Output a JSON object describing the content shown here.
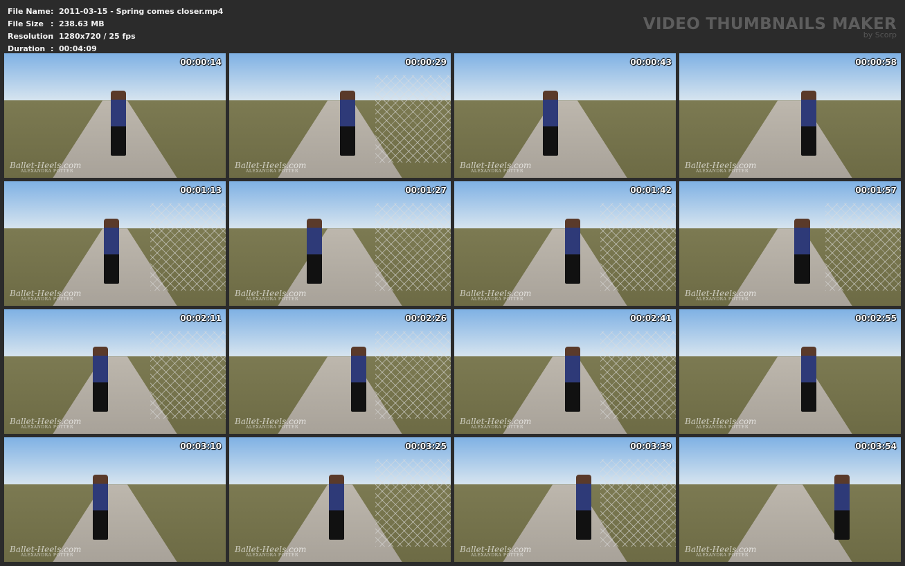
{
  "info": {
    "file_name_label": "File Name",
    "file_name": "2011-03-15 - Spring comes closer.mp4",
    "file_size_label": "File Size",
    "file_size": "238.63 MB",
    "resolution_label": "Resolution",
    "resolution": "1280x720 / 25 fps",
    "duration_label": "Duration",
    "duration": "00:04:09",
    "separator": ":"
  },
  "brand": {
    "title": "VIDEO THUMBNAILS MAKER",
    "by": "by Scorp"
  },
  "watermark": {
    "brand": "Ballet-Heels.com",
    "model": "ALEXANDRA POTTER"
  },
  "thumbnails": [
    {
      "timestamp": "00:00:14"
    },
    {
      "timestamp": "00:00:29"
    },
    {
      "timestamp": "00:00:43"
    },
    {
      "timestamp": "00:00:58"
    },
    {
      "timestamp": "00:01:13"
    },
    {
      "timestamp": "00:01:27"
    },
    {
      "timestamp": "00:01:42"
    },
    {
      "timestamp": "00:01:57"
    },
    {
      "timestamp": "00:02:11"
    },
    {
      "timestamp": "00:02:26"
    },
    {
      "timestamp": "00:02:41"
    },
    {
      "timestamp": "00:02:55"
    },
    {
      "timestamp": "00:03:10"
    },
    {
      "timestamp": "00:03:25"
    },
    {
      "timestamp": "00:03:39"
    },
    {
      "timestamp": "00:03:54"
    }
  ]
}
